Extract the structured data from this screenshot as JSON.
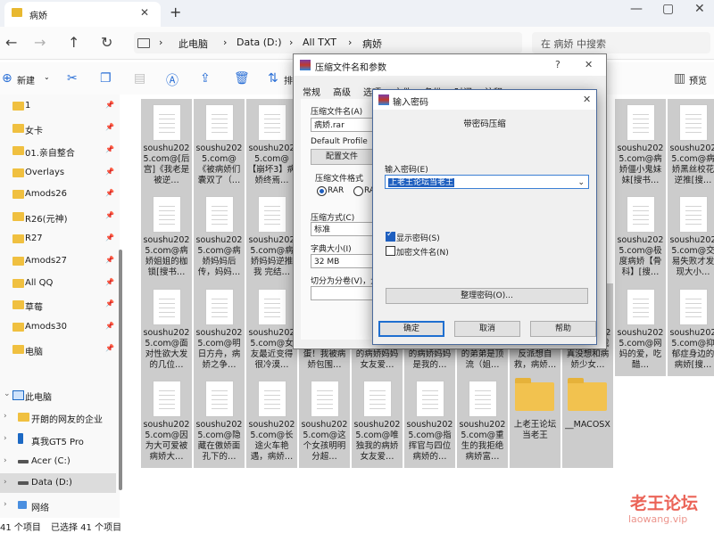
{
  "titlebar": {
    "tab_label": "病娇",
    "close": "✕",
    "new_tab": "+",
    "minimize": "—",
    "maximize": "▢",
    "close_window": "✕"
  },
  "address": {
    "back": "←",
    "forward": "→",
    "up": "↑",
    "refresh": "↻",
    "crumbs": [
      "此电脑",
      "Data (D:)",
      "All TXT",
      "病娇"
    ],
    "separator": "›",
    "search_placeholder": "在 病娇 中搜索"
  },
  "toolbar": {
    "new_label": "新建",
    "sort_label": "排",
    "preview_label": "预览"
  },
  "sidebar": {
    "pinned": [
      "1",
      "女卡",
      "01.亲自整合",
      "Overlays",
      "Amods26",
      "R26(元神)",
      "R27",
      "Amods27",
      "All QQ",
      "草莓",
      "Amods30",
      "电脑"
    ],
    "this_pc": "此电脑",
    "devices": [
      "开朗的网友的企业",
      "真我GT5 Pro",
      "Acer (C:)",
      "Data (D:)"
    ],
    "network": "网络"
  },
  "files": {
    "row1": [
      "soushu2025.com@[后宫]《我老是被逆…",
      "soushu2025.com@《被病娇们囊双了（…",
      "soushu2025.com@【崩坏3】病娇终焉…",
      "",
      "",
      "",
      "",
      "",
      "soushu2025.com@病娇僵小鬼妹妹[搜书…",
      "soushu2025.com@病娇黑丝校花逆推[搜…"
    ],
    "row2": [
      "soushu2025.com@病娇姐姐的枷锁[搜书…",
      "soushu2025.com@病娇妈妈后传，妈妈…",
      "soushu2025.com@病娇妈妈逆推我 完结…",
      "",
      "",
      "",
      "",
      "",
      "soushu2025.com@极度病娇【骨科】[搜…",
      "soushu2025.com@交易失败才发现大小…"
    ],
    "row3": [
      "soushu2025.com@面对性欲大发的几位…",
      "soushu2025.com@明日方舟，病娇之争…",
      "soushu2025.com@女友最近变得很冷漠…",
      "soushu2025.com@完蛋！我被病娇包围…",
      "soushu2025.com@我的病娇妈妈女友爱…",
      "soushu2025.com@我的病娇妈妈是我的…",
      "soushu2025.com@我的弟弟是顶流（姐…",
      "soushu2025.com@我反派想自救，病娇…",
      "soushu2025.com@我真没想和病娇少女…",
      "soushu2025.com@网妈的爱，吃醋…",
      "soushu2025.com@抑郁症身边的病娇[搜…"
    ],
    "row4": [
      "soushu2025.com@因为大可爱被病娇大…",
      "soushu2025.com@隐藏在傲娇面孔下的…",
      "soushu2025.com@长途火车艳遇，病娇…",
      "soushu2025.com@这个女孩明明分超…",
      "soushu2025.com@唯独我的病娇女友爱…",
      "soushu2025.com@指挥官与四位病娇的…",
      "soushu2025.com@重生的我拒绝病娇富…",
      "上老王论坛当老王",
      "__MACOSX"
    ]
  },
  "status": {
    "count": "41 个项目",
    "selected": "已选择 41 个项目"
  },
  "dialog_archive": {
    "title": "压缩文件名和参数",
    "help": "?",
    "close": "✕",
    "tabs": [
      "常规",
      "高级",
      "选项",
      "文件",
      "备份",
      "时间",
      "注释"
    ],
    "archive_name_label": "压缩文件名(A)",
    "archive_name": "病娇.rar",
    "profile_label": "Default Profile",
    "profile_button": "配置文件",
    "format_label": "压缩文件格式",
    "format_rar": "RAR",
    "format_other": "RA",
    "method_label": "压缩方式(C)",
    "method_value": "标准",
    "dict_label": "字典大小(I)",
    "dict_value": "32 MB",
    "split_label": "切分为分卷(V)，大"
  },
  "dialog_password": {
    "title": "输入密码",
    "close": "✕",
    "heading": "带密码压缩",
    "password_label": "输入密码(E)",
    "password_value": "上老王论坛当老王",
    "show_password": "显示密码(S)",
    "encrypt_names": "加密文件名(N)",
    "organize_button": "整理密码(O)...",
    "ok": "确定",
    "cancel": "取消",
    "help": "帮助"
  },
  "watermark": {
    "line1": "老王论坛",
    "line2": "laowang.vip"
  }
}
